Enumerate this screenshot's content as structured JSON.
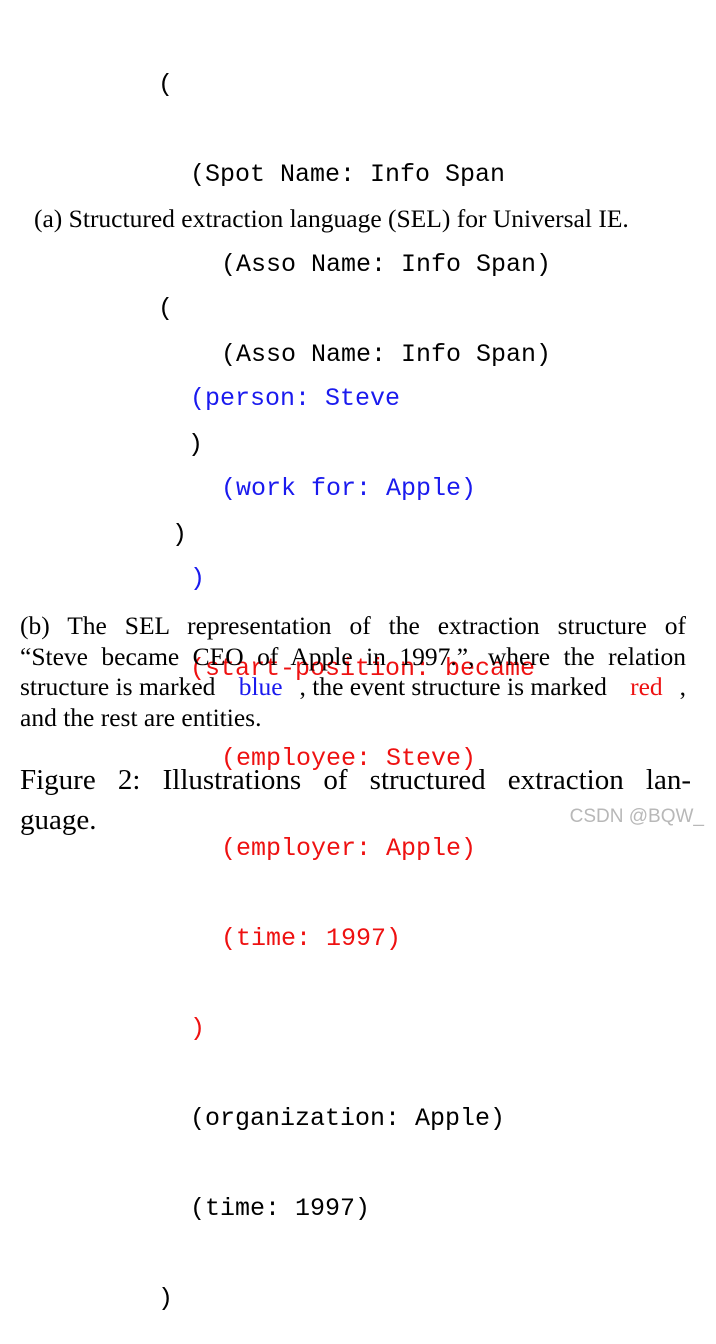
{
  "block_a": {
    "lines": [
      "(",
      "(Spot Name: Info Span",
      "(Asso Name: Info Span)",
      "(Asso Name: Info Span)",
      ")",
      ")"
    ],
    "caption": "(a) Structured extraction language (SEL) for Universal IE."
  },
  "block_b": {
    "lines": [
      "(",
      "(person: Steve",
      "(work for: Apple)",
      ")",
      "(start-position: became",
      "(employee: Steve)",
      "(employer: Apple)",
      "(time: 1997)",
      ")",
      "(organization: Apple)",
      "(time: 1997)",
      ")"
    ],
    "caption": {
      "line1": "(b) The SEL representation of the extraction structure of",
      "line2": "“Steve became CEO of Apple in 1997.”, where the relation",
      "line3_pre": "structure is marked ",
      "blue_word": "blue",
      "line3_mid": ", the event structure is marked ",
      "red_word": "red",
      "line3_post": ",",
      "line4": "and the rest are entities."
    },
    "colors": {
      "relation": "#1a1aee",
      "event": "#ee1111"
    }
  },
  "figure": {
    "line1": "Figure 2:  Illustrations of structured extraction lan-",
    "line2": "guage."
  },
  "watermark": "CSDN @BQW_"
}
